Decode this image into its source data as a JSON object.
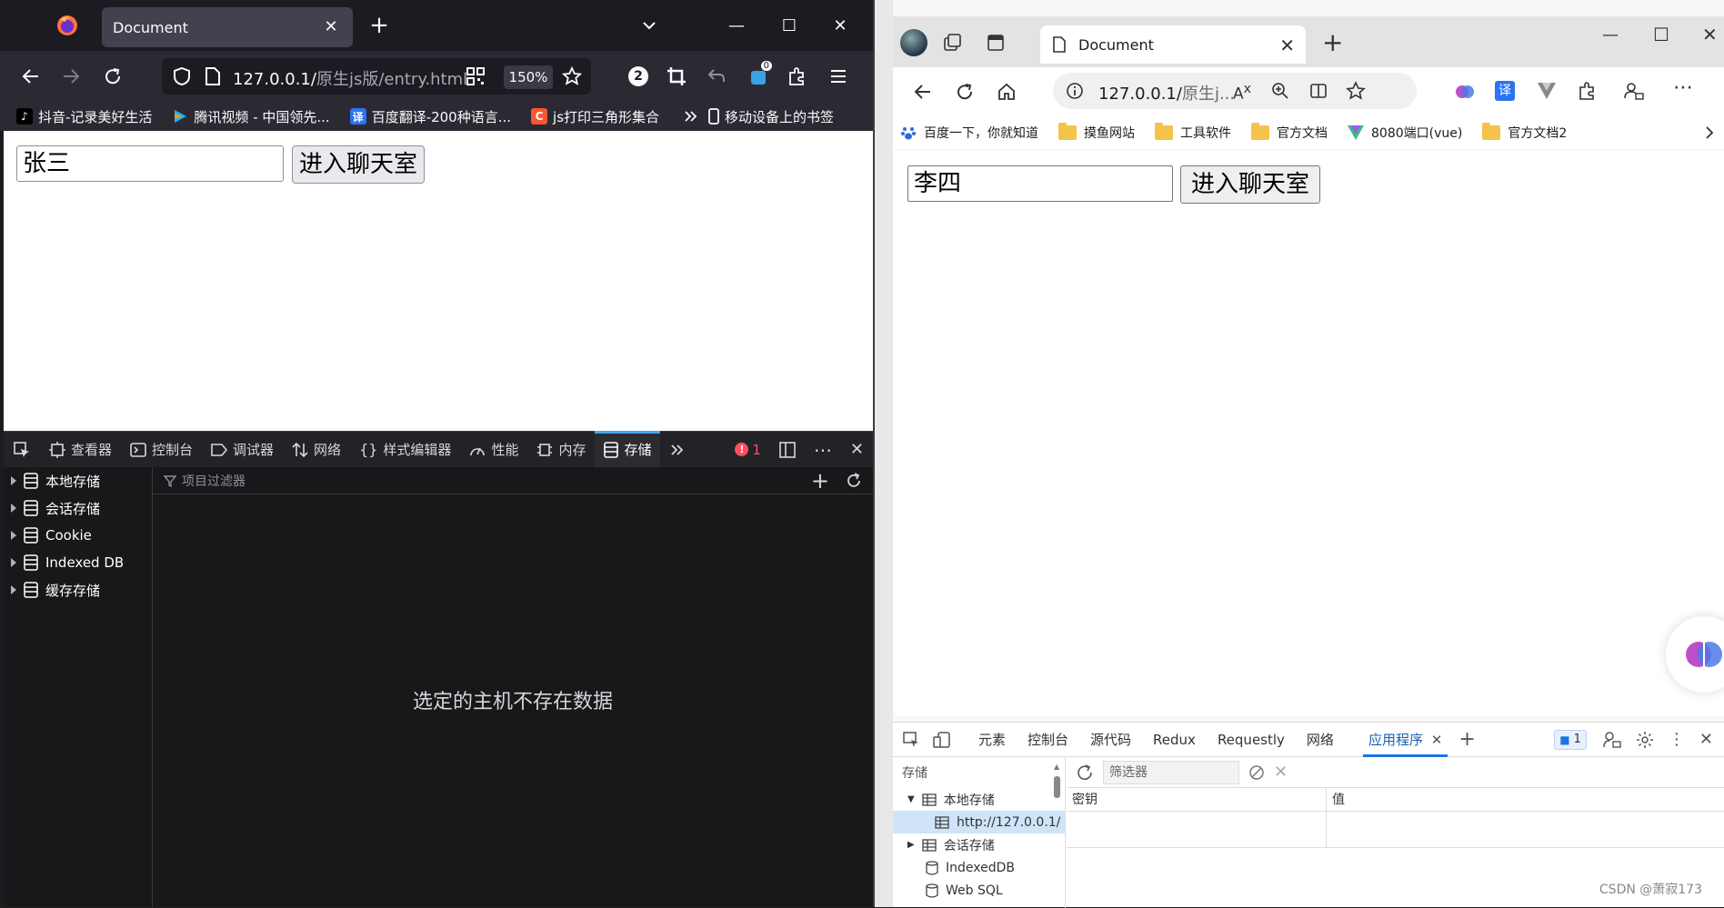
{
  "firefox": {
    "tab_title": "Document",
    "url_host": "127.0.0.1/",
    "url_path": "原生js版/entry.html",
    "zoom": "150%",
    "badge_count": "2",
    "extension_badge": "0",
    "bookmarks": [
      {
        "label": "抖音-记录美好生活",
        "icon": "tiktok-icon",
        "color": "#000000"
      },
      {
        "label": "腾讯视频 - 中国领先...",
        "icon": "tencent-video-icon",
        "color": "#20b0ff"
      },
      {
        "label": "百度翻译-200种语言...",
        "icon": "baidu-translate-icon",
        "color": "#2b74f2"
      },
      {
        "label": "js打印三角形集合",
        "icon": "csdn-icon",
        "color": "#fc5531"
      }
    ],
    "mobile_bookmarks": "移动设备上的书签",
    "page": {
      "name_value": "张三",
      "enter_button": "进入聊天室"
    },
    "devtools": {
      "tools": [
        {
          "label": "查看器",
          "icon": "inspector-icon"
        },
        {
          "label": "控制台",
          "icon": "console-icon"
        },
        {
          "label": "调试器",
          "icon": "debugger-icon"
        },
        {
          "label": "网络",
          "icon": "network-icon"
        },
        {
          "label": "样式编辑器",
          "icon": "style-editor-icon"
        },
        {
          "label": "性能",
          "icon": "performance-icon"
        },
        {
          "label": "内存",
          "icon": "memory-icon"
        },
        {
          "label": "存储",
          "icon": "storage-icon"
        }
      ],
      "error_count": "1",
      "storage_tree": [
        "本地存储",
        "会话存储",
        "Cookie",
        "Indexed DB",
        "缓存存储"
      ],
      "filter_placeholder": "项目过滤器",
      "empty_message": "选定的主机不存在数据"
    }
  },
  "edge": {
    "tab_title": "Document",
    "url_host": "127.0.0.1/",
    "url_rest": "原生j...",
    "bookmarks": [
      {
        "label": "百度一下，你就知道",
        "icon": "baidu-paw-icon"
      },
      {
        "label": "摸鱼网站",
        "icon": "folder-icon"
      },
      {
        "label": "工具软件",
        "icon": "folder-icon"
      },
      {
        "label": "官方文档",
        "icon": "folder-icon"
      },
      {
        "label": "8080端口(vue)",
        "icon": "vue-icon"
      },
      {
        "label": "官方文档2",
        "icon": "folder-icon"
      }
    ],
    "page": {
      "name_value": "李四",
      "enter_button": "进入聊天室"
    },
    "devtools": {
      "tabs": [
        "元素",
        "控制台",
        "源代码",
        "Redux",
        "Requestly",
        "网络",
        "应用程序"
      ],
      "issue_count": "1",
      "storage_label": "存储",
      "tree": [
        {
          "label": "本地存储",
          "level": 1,
          "expanded": true
        },
        {
          "label": "http://127.0.0.1/",
          "level": 2,
          "selected": true
        },
        {
          "label": "会话存储",
          "level": 1,
          "expanded": false
        },
        {
          "label": "IndexedDB",
          "level": 1
        },
        {
          "label": "Web SQL",
          "level": 1
        }
      ],
      "filter_placeholder": "筛选器",
      "columns": [
        "密钥",
        "值"
      ]
    },
    "watermark": "CSDN @萧寂173"
  },
  "colors": {
    "ff_accent": "#3ca8fe",
    "edge_accent": "#1a73e8",
    "firefox_dark": "#1c1b22"
  }
}
